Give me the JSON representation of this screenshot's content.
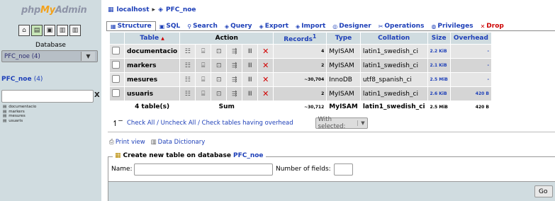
{
  "nav": {
    "logo_php": "php",
    "logo_my": "My",
    "logo_admin": "Admin",
    "icons": [
      "home-icon",
      "query-window-icon",
      "sql-icon",
      "docs-icon",
      "docs-icon"
    ],
    "database_label": "Database",
    "database_select": "PFC_noe (4)",
    "db_link": "PFC_noe",
    "db_link_count": "(4)",
    "filter_placeholder": "",
    "filter_clear": "X",
    "tables": [
      "documentacio",
      "markers",
      "mesures",
      "usuaris"
    ]
  },
  "breadcrumb": {
    "server": "localhost",
    "separator": "▸",
    "database": "PFC_noe"
  },
  "tabs": [
    {
      "label": "Structure",
      "icon": "structure-icon"
    },
    {
      "label": "SQL",
      "icon": "sql-icon"
    },
    {
      "label": "Search",
      "icon": "search-icon"
    },
    {
      "label": "Query",
      "icon": "query-icon"
    },
    {
      "label": "Export",
      "icon": "export-icon"
    },
    {
      "label": "Import",
      "icon": "import-icon"
    },
    {
      "label": "Designer",
      "icon": "designer-icon"
    },
    {
      "label": "Operations",
      "icon": "operations-icon"
    },
    {
      "label": "Privileges",
      "icon": "privileges-icon"
    },
    {
      "label": "Drop",
      "icon": "drop-icon"
    }
  ],
  "table": {
    "headers": {
      "table": "Table",
      "sort_arrow": "▲",
      "action": "Action",
      "records": "Records",
      "records_sup": "1",
      "type": "Type",
      "collation": "Collation",
      "size": "Size",
      "overhead": "Overhead"
    },
    "rows": [
      {
        "name": "documentacio",
        "records": "4",
        "type": "MyISAM",
        "collation": "latin1_swedish_ci",
        "size": "2.2 KiB",
        "overhead": "-"
      },
      {
        "name": "markers",
        "records": "2",
        "type": "MyISAM",
        "collation": "latin1_swedish_ci",
        "size": "2.1 KiB",
        "overhead": "-"
      },
      {
        "name": "mesures",
        "records": "~30,704",
        "type": "InnoDB",
        "collation": "utf8_spanish_ci",
        "size": "2.5 MiB",
        "overhead": "-"
      },
      {
        "name": "usuaris",
        "records": "2",
        "type": "MyISAM",
        "collation": "latin1_swedish_ci",
        "size": "2.6 KiB",
        "overhead": "420 B"
      }
    ],
    "footer": {
      "tables": "4 table(s)",
      "sum": "Sum",
      "records": "~30,712",
      "type": "MyISAM",
      "collation": "latin1_swedish_ci",
      "size": "2.5 MiB",
      "overhead": "420 B"
    }
  },
  "checkall": {
    "text": "Check All / Uncheck All / Check tables having overhead",
    "with_selected": "With selected:"
  },
  "links": {
    "print_view": "Print view",
    "data_dictionary": "Data Dictionary"
  },
  "create": {
    "legend_prefix": "Create new table on database",
    "database": "PFC_noe",
    "name_label": "Name:",
    "fields_label": "Number of fields:",
    "go": "Go"
  }
}
